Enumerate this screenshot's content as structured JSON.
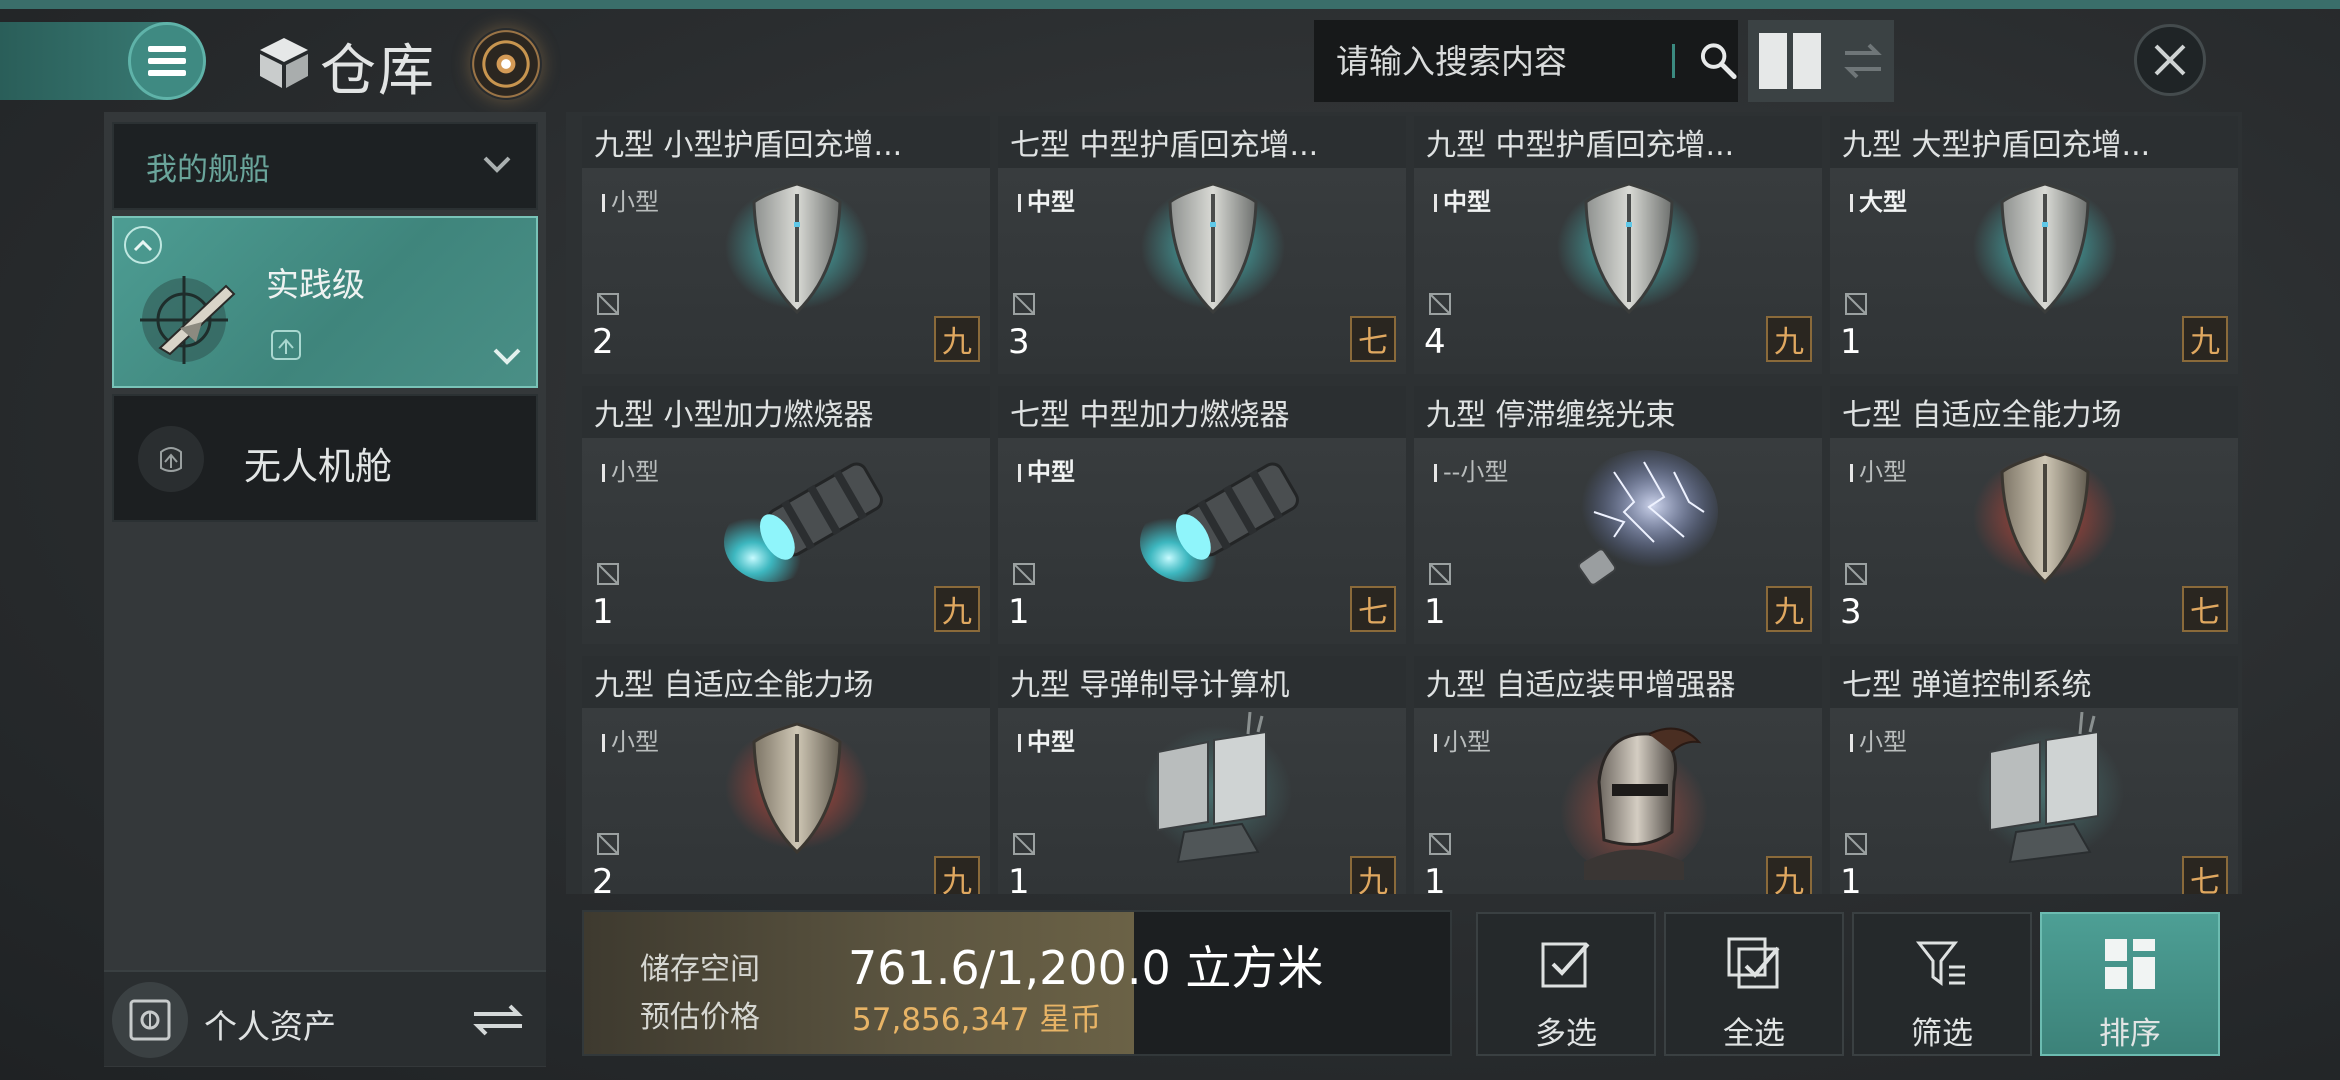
{
  "header": {
    "title": "仓库",
    "search_placeholder": "请输入搜索内容",
    "icons": [
      "menu-icon",
      "cube-icon",
      "orb-icon",
      "search-icon",
      "grid-view-icon",
      "swap-view-icon",
      "close-icon"
    ]
  },
  "sidebar": {
    "ship_dropdown": "我的舰船",
    "ship_card_label": "实践级",
    "drone_bay_label": "无人机舱",
    "assets_label": "个人资产"
  },
  "items": [
    {
      "name": "九型 小型护盾回充增...",
      "size": "小型",
      "qty": "2",
      "tier": "九",
      "art": "shield-cyan",
      "size_bold": false
    },
    {
      "name": "七型 中型护盾回充增...",
      "size": "中型",
      "qty": "3",
      "tier": "七",
      "art": "shield-cyan",
      "size_bold": true
    },
    {
      "name": "九型 中型护盾回充增...",
      "size": "中型",
      "qty": "4",
      "tier": "九",
      "art": "shield-cyan",
      "size_bold": true
    },
    {
      "name": "九型 大型护盾回充增...",
      "size": "大型",
      "qty": "1",
      "tier": "九",
      "art": "shield-cyan",
      "size_bold": true
    },
    {
      "name": "九型 小型加力燃烧器",
      "size": "小型",
      "qty": "1",
      "tier": "九",
      "art": "thruster",
      "size_bold": false
    },
    {
      "name": "七型 中型加力燃烧器",
      "size": "中型",
      "qty": "1",
      "tier": "七",
      "art": "thruster",
      "size_bold": true
    },
    {
      "name": "九型 停滞缠绕光束",
      "size": "--小型",
      "qty": "1",
      "tier": "九",
      "art": "lightning",
      "size_bold": false
    },
    {
      "name": "七型 自适应全能力场",
      "size": "小型",
      "qty": "3",
      "tier": "七",
      "art": "shield-red",
      "size_bold": false
    },
    {
      "name": "九型 自适应全能力场",
      "size": "小型",
      "qty": "2",
      "tier": "九",
      "art": "shield-red",
      "size_bold": false
    },
    {
      "name": "九型 导弹制导计算机",
      "size": "中型",
      "qty": "1",
      "tier": "九",
      "art": "computer",
      "size_bold": true
    },
    {
      "name": "九型 自适应装甲增强器",
      "size": "小型",
      "qty": "1",
      "tier": "九",
      "art": "helmet",
      "size_bold": false
    },
    {
      "name": "七型 弹道控制系统",
      "size": "小型",
      "qty": "1",
      "tier": "七",
      "art": "computer",
      "size_bold": false
    }
  ],
  "storage": {
    "space_label": "储存空间",
    "price_label": "预估价格",
    "space_value": "761.6/1,200.0 立方米",
    "price_value": "57,856,347 星币",
    "fill_fraction": 0.635
  },
  "actions": [
    {
      "label": "多选",
      "icon": "checkbox-icon"
    },
    {
      "label": "全选",
      "icon": "check-all-icon"
    },
    {
      "label": "筛选",
      "icon": "filter-icon"
    },
    {
      "label": "排序",
      "icon": "sort-icon"
    }
  ],
  "colors": {
    "accent_teal": "#4d9f95",
    "tier_gold": "#e0a860",
    "price_gold": "#e8b466"
  }
}
